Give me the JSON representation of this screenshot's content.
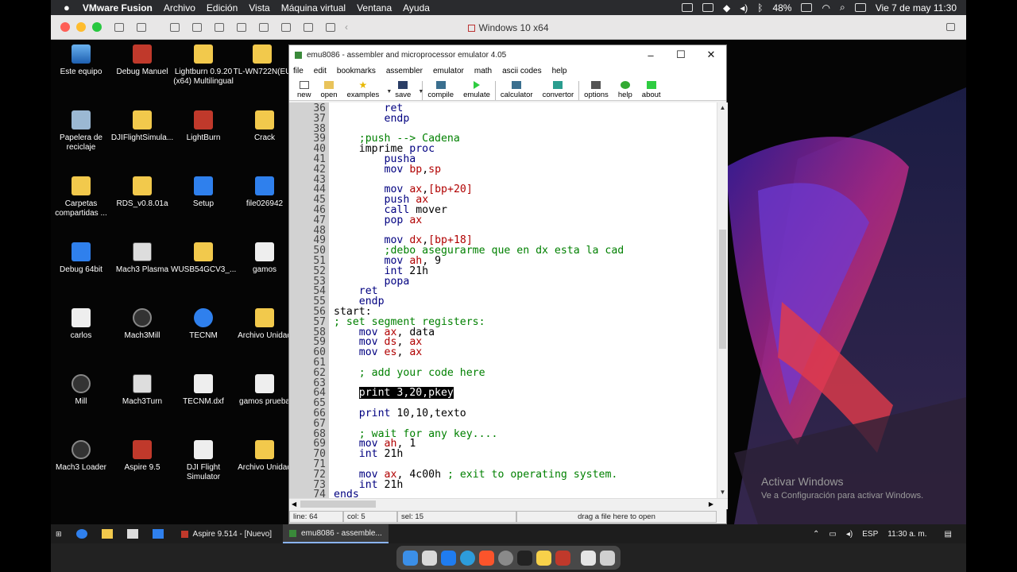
{
  "mac_menubar": {
    "app_name": "VMware Fusion",
    "menus": [
      "Archivo",
      "Edición",
      "Vista",
      "Máquina virtual",
      "Ventana",
      "Ayuda"
    ],
    "battery": "48%",
    "datetime": "Vie 7 de may  11:30"
  },
  "vm_window": {
    "title": "Windows 10 x64"
  },
  "desktop_icons": [
    {
      "label": "Este equipo",
      "icon": "pc-icon"
    },
    {
      "label": "Debug Manuel",
      "icon": "app-icon"
    },
    {
      "label": "Lightburn 0.9.20 (x64) Multilingual",
      "icon": "folder-icon"
    },
    {
      "label": "TL-WN722N(EU",
      "icon": "folder-icon"
    },
    {
      "label": "Papelera de reciclaje",
      "icon": "recycle-bin-icon"
    },
    {
      "label": "DJIFlightSimula...",
      "icon": "installer-icon"
    },
    {
      "label": "LightBurn",
      "icon": "lightburn-icon"
    },
    {
      "label": "Crack",
      "icon": "folder-icon"
    },
    {
      "label": "Carpetas compartidas ...",
      "icon": "shared-folder-icon"
    },
    {
      "label": "RDS_v0.8.01a",
      "icon": "folder-icon"
    },
    {
      "label": "Setup",
      "icon": "setup-icon"
    },
    {
      "label": "file026942",
      "icon": "image-icon"
    },
    {
      "label": "Debug 64bit",
      "icon": "debug-icon"
    },
    {
      "label": "Mach3 Plasma",
      "icon": "cnc-icon"
    },
    {
      "label": "WUSB54GCV3_...",
      "icon": "folder-icon"
    },
    {
      "label": "gamos",
      "icon": "image-icon"
    },
    {
      "label": "carlos",
      "icon": "document-icon"
    },
    {
      "label": "Mach3Mill",
      "icon": "mach3-icon"
    },
    {
      "label": "TECNM",
      "icon": "edge-icon"
    },
    {
      "label": "Archivo Unidad",
      "icon": "folder-icon"
    },
    {
      "label": "Mill",
      "icon": "mach3-icon"
    },
    {
      "label": "Mach3Turn",
      "icon": "cnc-icon"
    },
    {
      "label": "TECNM.dxf",
      "icon": "file-icon"
    },
    {
      "label": "gamos prueba",
      "icon": "image-icon"
    },
    {
      "label": "Mach3 Loader",
      "icon": "mach3-icon"
    },
    {
      "label": "Aspire 9.5",
      "icon": "aspire-icon"
    },
    {
      "label": "DJI Flight Simulator",
      "icon": "dji-icon"
    },
    {
      "label": "Archivo Unidad",
      "icon": "folder-icon"
    }
  ],
  "watermark": {
    "line1": "Activar Windows",
    "line2": "Ve a Configuración para activar Windows."
  },
  "emu": {
    "title": "emu8086 - assembler and microprocessor emulator 4.05",
    "menu": [
      "file",
      "edit",
      "bookmarks",
      "assembler",
      "emulator",
      "math",
      "ascii codes",
      "help"
    ],
    "toolbar": {
      "new": "new",
      "open": "open",
      "examples": "examples",
      "save": "save",
      "compile": "compile",
      "emulate": "emulate",
      "calculator": "calculator",
      "convertor": "convertor",
      "options": "options",
      "help": "help",
      "about": "about"
    },
    "code": [
      {
        "n": "36",
        "t": "        ret"
      },
      {
        "n": "37",
        "t": "        endp"
      },
      {
        "n": "38",
        "t": ""
      },
      {
        "n": "39",
        "t": "    ;push --> Cadena"
      },
      {
        "n": "40",
        "t": "    imprime proc"
      },
      {
        "n": "41",
        "t": "        pusha"
      },
      {
        "n": "42",
        "t": "        mov bp,sp"
      },
      {
        "n": "43",
        "t": ""
      },
      {
        "n": "44",
        "t": "        mov ax,[bp+20]"
      },
      {
        "n": "45",
        "t": "        push ax"
      },
      {
        "n": "46",
        "t": "        call mover"
      },
      {
        "n": "47",
        "t": "        pop ax"
      },
      {
        "n": "48",
        "t": ""
      },
      {
        "n": "49",
        "t": "        mov dx,[bp+18]"
      },
      {
        "n": "50",
        "t": "        ;debo asegurarme que en dx esta la cad"
      },
      {
        "n": "51",
        "t": "        mov ah, 9"
      },
      {
        "n": "52",
        "t": "        int 21h"
      },
      {
        "n": "53",
        "t": "        popa"
      },
      {
        "n": "54",
        "t": "    ret"
      },
      {
        "n": "55",
        "t": "    endp"
      },
      {
        "n": "56",
        "t": "start:"
      },
      {
        "n": "57",
        "t": "; set segment registers:"
      },
      {
        "n": "58",
        "t": "    mov ax, data"
      },
      {
        "n": "59",
        "t": "    mov ds, ax"
      },
      {
        "n": "60",
        "t": "    mov es, ax"
      },
      {
        "n": "61",
        "t": ""
      },
      {
        "n": "62",
        "t": "    ; add your code here"
      },
      {
        "n": "63",
        "t": ""
      },
      {
        "n": "64",
        "t": "    print 3,20,pkey"
      },
      {
        "n": "65",
        "t": ""
      },
      {
        "n": "66",
        "t": "    print 10,10,texto"
      },
      {
        "n": "67",
        "t": ""
      },
      {
        "n": "68",
        "t": "    ; wait for any key...."
      },
      {
        "n": "69",
        "t": "    mov ah, 1"
      },
      {
        "n": "70",
        "t": "    int 21h"
      },
      {
        "n": "71",
        "t": ""
      },
      {
        "n": "72",
        "t": "    mov ax, 4c00h ; exit to operating system."
      },
      {
        "n": "73",
        "t": "    int 21h"
      },
      {
        "n": "74",
        "t": "ends"
      }
    ],
    "status": {
      "line": "line: 64",
      "col": "col: 5",
      "sel": "sel: 15",
      "drop": "drag a file here to open"
    }
  },
  "taskbar": {
    "apps": [
      {
        "label": "Aspire 9.514 - [Nuevo]",
        "active": false
      },
      {
        "label": "emu8086 - assemble...",
        "active": true
      }
    ],
    "lang": "ESP",
    "time": "11:30 a. m."
  },
  "colors": {
    "keyword": "#000080",
    "register": "#b00000",
    "comment": "#008000",
    "gutter": "#d2d2d2"
  }
}
